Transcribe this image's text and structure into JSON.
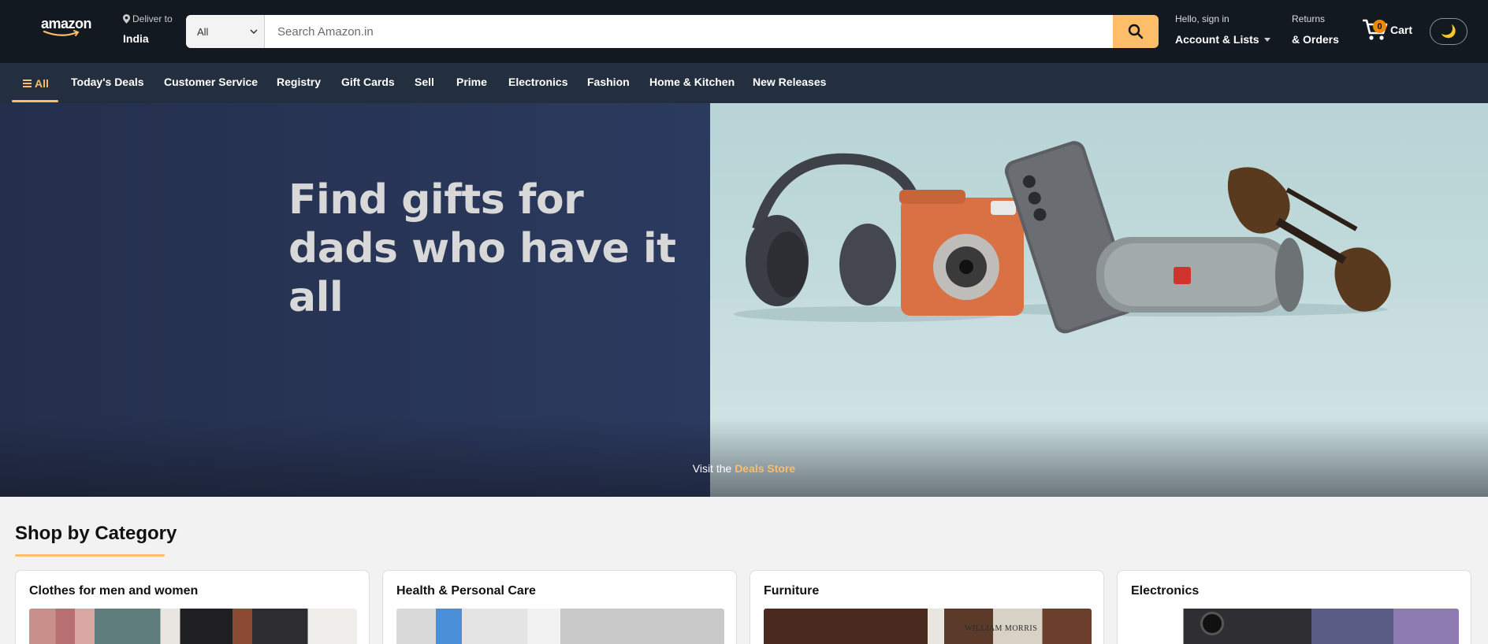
{
  "header": {
    "logo_text": "amazon",
    "deliver_label": "Deliver to",
    "deliver_location": "India",
    "search": {
      "category_selected": "All",
      "placeholder": "Search Amazon.in"
    },
    "account_greeting": "Hello, sign in",
    "account_label": "Account & Lists",
    "returns_label": "Returns",
    "orders_label": "& Orders",
    "cart_count": "0",
    "cart_label": "Cart",
    "theme_icon": "moon-icon"
  },
  "nav": {
    "all_label": "All",
    "items": [
      "Today's Deals",
      "Customer Service",
      "Registry",
      "Gift Cards",
      "Sell",
      "Prime",
      "Electronics",
      "Fashion",
      "Home & Kitchen",
      "New Releases"
    ]
  },
  "hero": {
    "heading_line1": "Find gifts for",
    "heading_line2": "dads who have it all",
    "cta_prefix": "Visit the",
    "cta_link": "Deals Store"
  },
  "categories": {
    "title": "Shop by Category",
    "cards": [
      {
        "title": "Clothes for men and women"
      },
      {
        "title": "Health & Personal Care"
      },
      {
        "title": "Furniture",
        "image_text": "WILLIAM MORRIS"
      },
      {
        "title": "Electronics"
      }
    ]
  },
  "colors": {
    "header_bg": "#131921",
    "subnav_bg": "#232f3e",
    "accent": "#febd69",
    "cart_badge": "#f08804"
  }
}
